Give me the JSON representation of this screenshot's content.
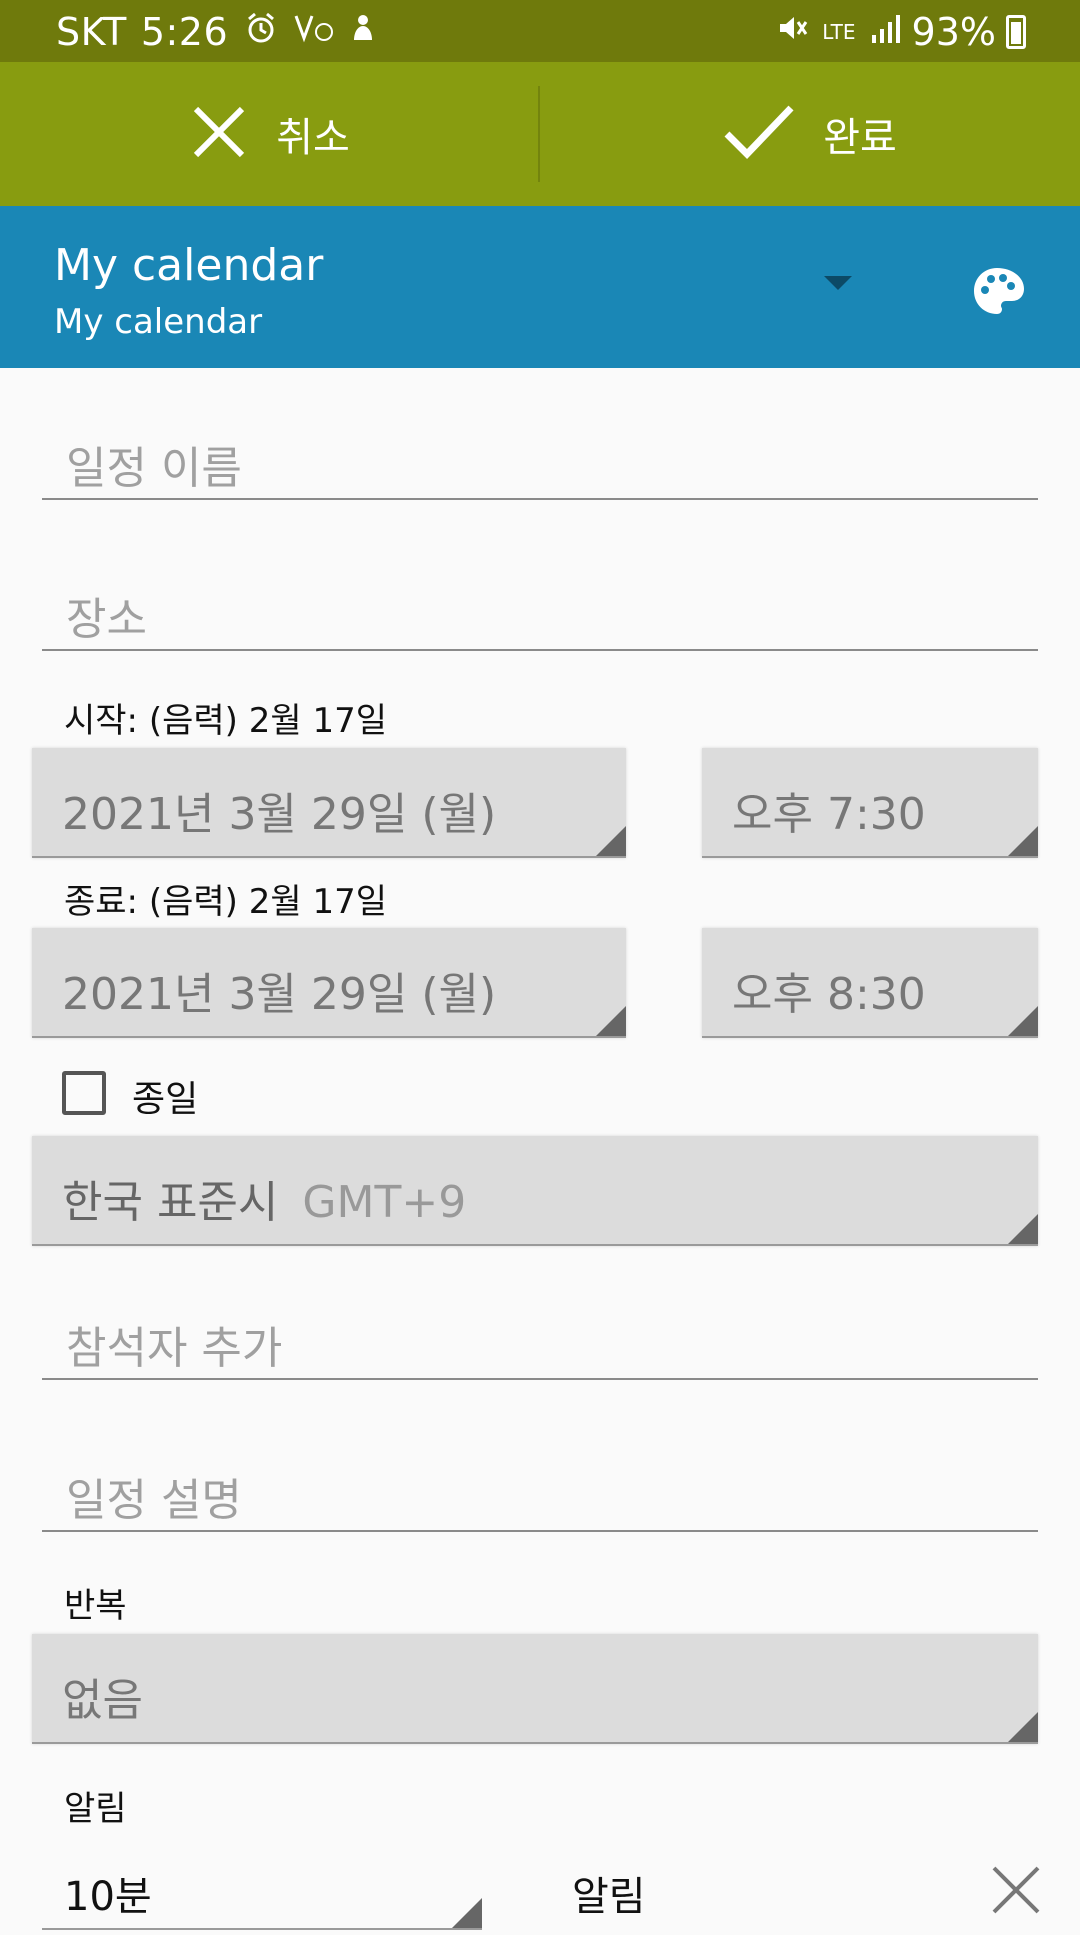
{
  "status_bar": {
    "carrier": "SKT",
    "time": "5:26",
    "network": "LTE",
    "battery": "93%"
  },
  "action_bar": {
    "cancel_label": "취소",
    "done_label": "완료"
  },
  "calendar": {
    "title": "My calendar",
    "subtitle": "My calendar",
    "color": "#1a87b6"
  },
  "form": {
    "title_placeholder": "일정 이름",
    "location_placeholder": "장소",
    "start_label": "시작:  (음력) 2월 17일",
    "start_date": "2021년 3월 29일 (월)",
    "start_time": "오후 7:30",
    "end_label": "종료:  (음력) 2월 17일",
    "end_date": "2021년 3월 29일 (월)",
    "end_time": "오후 8:30",
    "all_day_label": "종일",
    "all_day_checked": false,
    "timezone_name": "한국 표준시",
    "timezone_offset": "GMT+9",
    "attendees_placeholder": "참석자 추가",
    "description_placeholder": "일정 설명",
    "repeat_label": "반복",
    "repeat_value": "없음",
    "reminder_label": "알림",
    "reminder_time": "10분",
    "reminder_type": "알림"
  },
  "colors": {
    "status_bar": "#6f7a0c",
    "action_bar": "#889c10",
    "calendar_bar": "#1a87b6"
  }
}
